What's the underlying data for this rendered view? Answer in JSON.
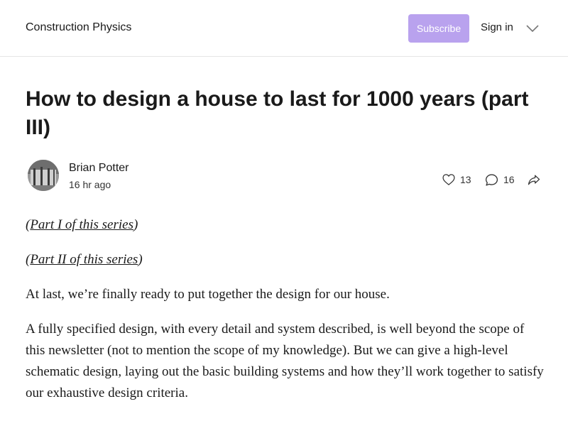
{
  "header": {
    "site_title": "Construction Physics",
    "subscribe_label": "Subscribe",
    "signin_label": "Sign in",
    "menu_icon": "chevron-down-icon"
  },
  "post": {
    "title": "How to design a house to last for 1000 years (part III)",
    "author": "Brian Potter",
    "date": "16 hr ago",
    "likes": "13",
    "comments": "16"
  },
  "body": {
    "link1": "Part I of this series",
    "link2": "Part II of this series",
    "para1": "At last, we’re finally ready to put together the design for our house.",
    "para2": "A fully specified design, with every detail and system described, is well beyond the scope of this newsletter (not to mention the scope of my knowledge). But we can give a high-level schematic design, laying out the basic building systems and how they’ll work together to satisfy our exhaustive design criteria."
  },
  "colors": {
    "accent": "#b9a2ee",
    "text": "#1a1a1a",
    "divider": "#e6e6e6"
  }
}
